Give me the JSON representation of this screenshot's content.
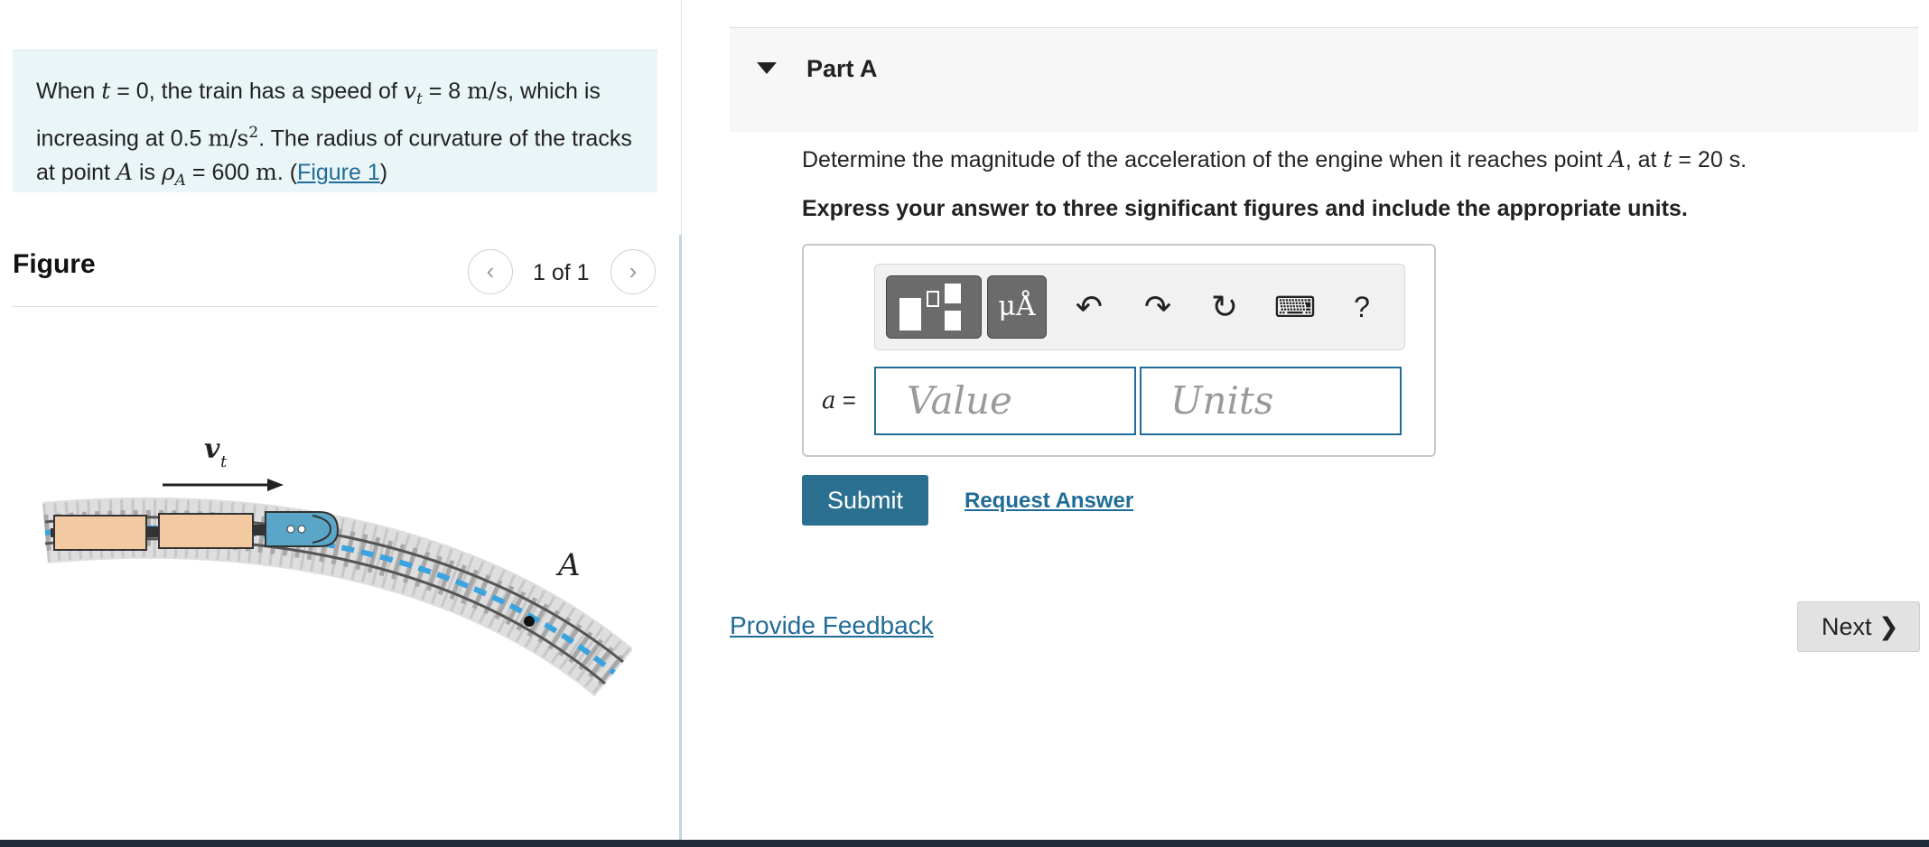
{
  "problem": {
    "segments": [
      "When ",
      "t",
      " = 0, the train has a speed of ",
      "v",
      "t",
      " = 8 ",
      "m/s",
      ", which is increasing at 0.5 ",
      "m/s",
      "2",
      ". The radius of curvature of the tracks at point ",
      "A",
      " is ",
      "ρ",
      "A",
      " = 600 ",
      "m",
      ". (",
      "Figure 1",
      ")"
    ]
  },
  "figure": {
    "title": "Figure",
    "counter": "1 of 1",
    "prev_symbol": "‹",
    "next_symbol": "›",
    "velocity_label": "v",
    "velocity_sub": "t",
    "point_label": "A"
  },
  "part": {
    "title": "Part A",
    "question_segments": [
      "Determine the magnitude of the acceleration of the engine when it reaches point ",
      "A",
      ", at ",
      "t",
      " = 20 s."
    ],
    "instructions": "Express your answer to three significant figures and include the appropriate units."
  },
  "answer": {
    "variable": "a",
    "equals": " =",
    "value_placeholder": "Value",
    "units_placeholder": "Units",
    "units_button": "μÅ",
    "undo_symbol": "↶",
    "redo_symbol": "↷",
    "reset_symbol": "↻",
    "keyboard_symbol": "⌨",
    "help_symbol": "?"
  },
  "actions": {
    "submit": "Submit",
    "request_answer": "Request Answer",
    "provide_feedback": "Provide Feedback",
    "next": "Next",
    "next_symbol": "❯"
  },
  "colors": {
    "accent": "#1f6c98",
    "submit_bg": "#2b6f91",
    "problem_bg": "#eaf5f7",
    "track_highlight": "#3ba3e0",
    "car_fill": "#f3c9a2"
  }
}
